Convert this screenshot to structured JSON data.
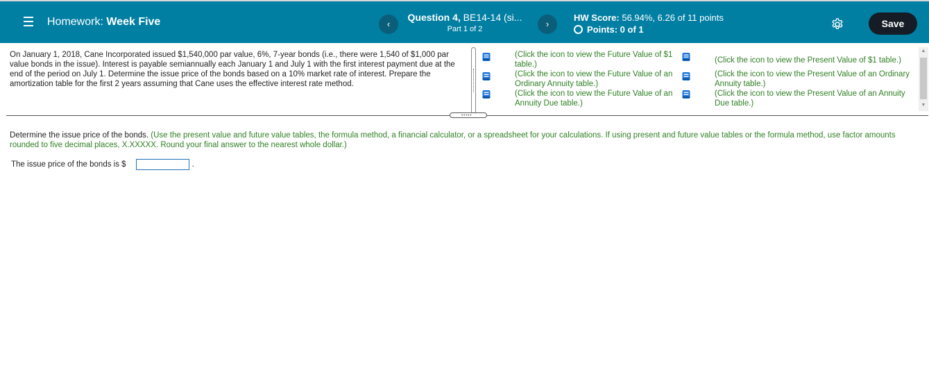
{
  "header": {
    "homework_prefix": "Homework:",
    "homework_name": "Week Five",
    "question_label": "Question 4,",
    "question_code": "BE14-14 (si...",
    "part": "Part 1 of 2",
    "prev_symbol": "‹",
    "next_symbol": "›",
    "score_label": "HW Score:",
    "score_value": "56.94%, 6.26 of 11 points",
    "points_text": "Points: 0 of 1",
    "save_label": "Save"
  },
  "problem": {
    "text": "On January 1, 2018, Cane Incorporated issued $1,540,000 par value, 6%, 7-year bonds (i.e., there were 1,540 of $1,000 par value bonds in the issue). Interest is payable semiannually each January 1 and July 1 with the first interest payment due at the end of the period on July 1. Determine the issue price of the bonds based on a 10% market rate of interest. Prepare the amortization table for the first 2 years assuming that Cane uses the effective interest rate method."
  },
  "tables": {
    "fv1": "(Click the icon to view the Future Value of $1 table.)",
    "fv_ordinary": "(Click the icon to view the Future Value of an Ordinary Annuity table.)",
    "fv_due": "(Click the icon to view the Future Value of an Annuity Due table.)",
    "pv1": "(Click the icon to view the Present Value of $1 table.)",
    "pv_ordinary": "(Click the icon to view the Present Value of an Ordinary Annuity table.)",
    "pv_due": "(Click the icon to view the Present Value of an Annuity Due table.)"
  },
  "instruction": {
    "main": "Determine the issue price of the bonds.",
    "note": "(Use the present value and future value tables, the formula method, a financial calculator, or a spreadsheet for your calculations. If using present and future value tables or the formula method, use factor amounts rounded to five decimal places, X.XXXXX. Round your final answer to the nearest whole dollar.)"
  },
  "answer": {
    "label": "The issue price of the bonds is $",
    "value": "",
    "suffix": "."
  },
  "icons": {
    "menu": "hamburger-menu-icon",
    "settings": "gear-icon",
    "table": "book-icon"
  },
  "colors": {
    "header_bg": "#007FA3",
    "nav_button": "#0B5E79",
    "save_button": "#161c26",
    "link_green": "#2F7F24",
    "book_blue": "#1a73d9"
  }
}
